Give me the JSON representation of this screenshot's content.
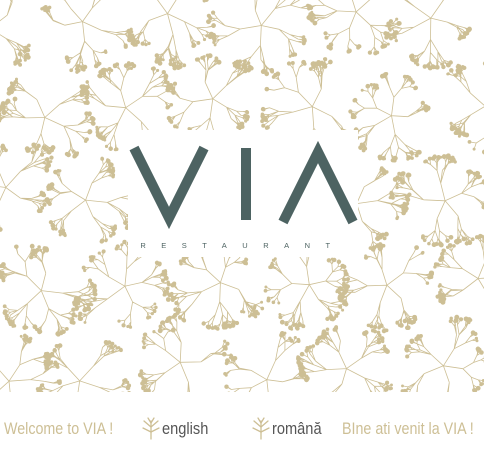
{
  "brand": {
    "logo_text": "VIA",
    "tagline": "RESTAURANT"
  },
  "footer": {
    "welcome_en": "Welcome to VIA !",
    "english_link": "english",
    "romana_link": "română",
    "welcome_ro": "BIne ati venit la VIA !"
  },
  "colors": {
    "accent": "#cdbf95",
    "logo": "#4d6362",
    "link": "#555555",
    "background": "#ffffff"
  },
  "icons": [
    "floral-pattern",
    "sprig-icon"
  ]
}
